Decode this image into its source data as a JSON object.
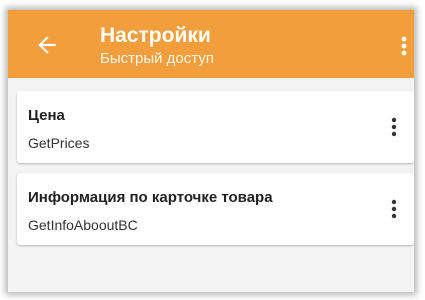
{
  "header": {
    "title": "Настройки",
    "subtitle": "Быстрый доступ",
    "back_icon": "arrow-left-icon",
    "menu_icon": "more-vertical-icon",
    "background_color": "#f29e3c",
    "text_color": "#ffffff"
  },
  "cards": [
    {
      "title": "Цена",
      "subtitle": "GetPrices",
      "menu_icon": "more-vertical-icon"
    },
    {
      "title": "Информация по карточке товара",
      "subtitle": "GetInfoAbooutBC",
      "menu_icon": "more-vertical-icon"
    }
  ]
}
